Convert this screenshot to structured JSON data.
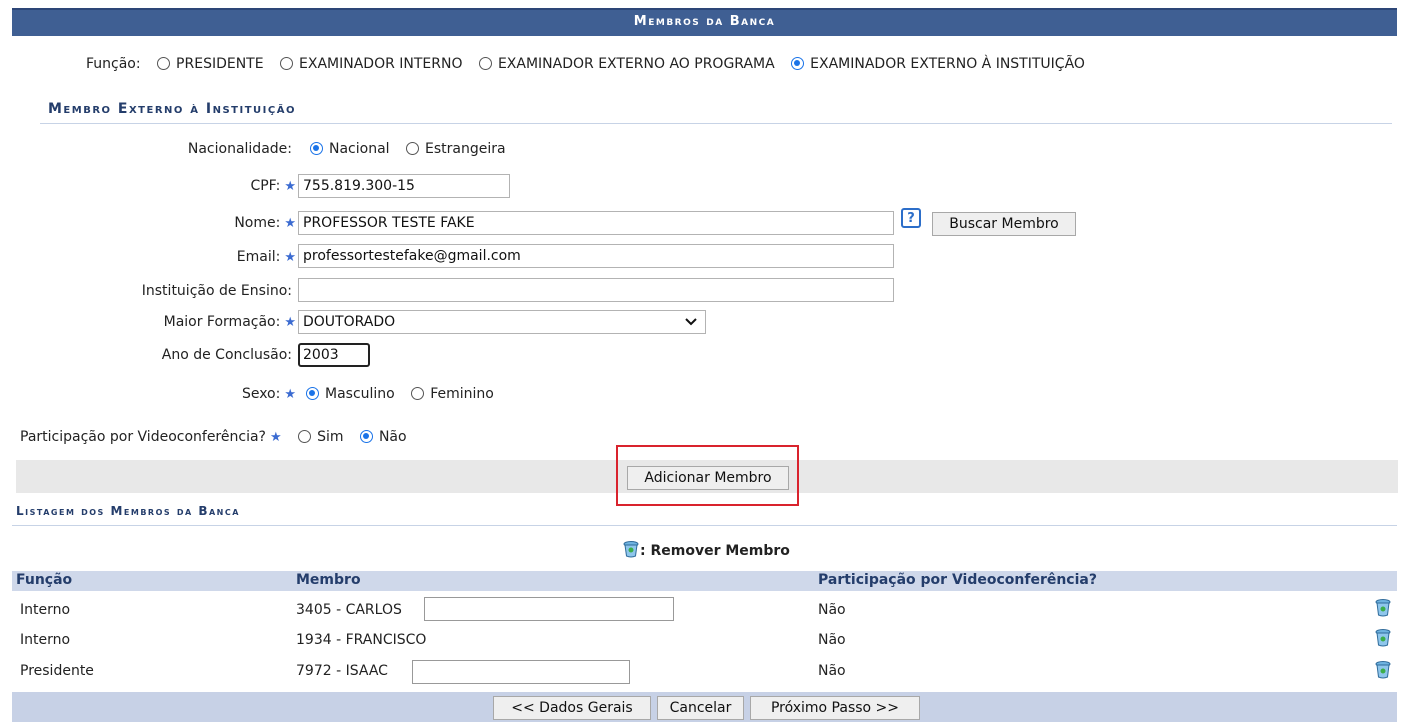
{
  "header": {
    "title": "Membros da Banca"
  },
  "funcao": {
    "label": "Função:",
    "options": [
      {
        "label": "PRESIDENTE",
        "selected": false
      },
      {
        "label": "EXAMINADOR INTERNO",
        "selected": false
      },
      {
        "label": "EXAMINADOR EXTERNO AO PROGRAMA",
        "selected": false
      },
      {
        "label": "EXAMINADOR EXTERNO À INSTITUIÇÃO",
        "selected": true
      }
    ]
  },
  "form": {
    "section_title": "Membro Externo à Instituição",
    "nacionalidade": {
      "label": "Nacionalidade:",
      "options": [
        {
          "label": "Nacional",
          "selected": true
        },
        {
          "label": "Estrangeira",
          "selected": false
        }
      ]
    },
    "cpf": {
      "label": "CPF:",
      "value": "755.819.300-15"
    },
    "nome": {
      "label": "Nome:",
      "value": "PROFESSOR TESTE FAKE",
      "help": "?",
      "search_button": "Buscar Membro"
    },
    "email": {
      "label": "Email:",
      "value": "professortestefake@gmail.com"
    },
    "instituicao": {
      "label": "Instituição de Ensino:",
      "value": ""
    },
    "maior_formacao": {
      "label": "Maior Formação:",
      "value": "DOUTORADO"
    },
    "ano_conclusao": {
      "label": "Ano de Conclusão:",
      "value": "2003"
    },
    "sexo": {
      "label": "Sexo:",
      "options": [
        {
          "label": "Masculino",
          "selected": true
        },
        {
          "label": "Feminino",
          "selected": false
        }
      ]
    },
    "videoconferencia": {
      "label": "Participação por Videoconferência?",
      "options": [
        {
          "label": "Sim",
          "selected": false
        },
        {
          "label": "Não",
          "selected": true
        }
      ]
    },
    "add_button": "Adicionar Membro"
  },
  "listing": {
    "section_title": "Listagem dos Membros da Banca",
    "legend": ": Remover Membro",
    "columns": [
      "Função",
      "Membro",
      "Participação por Videoconferência?"
    ],
    "rows": [
      {
        "funcao": "Interno",
        "membro": "3405 - CARLOS",
        "video": "Não"
      },
      {
        "funcao": "Interno",
        "membro": "1934 - FRANCISCO",
        "video": "Não"
      },
      {
        "funcao": "Presidente",
        "membro": "7972 - ISAAC",
        "video": "Não"
      }
    ]
  },
  "footer": {
    "back": "<< Dados Gerais",
    "cancel": "Cancelar",
    "next": "Próximo Passo >>"
  },
  "colors": {
    "header_bg": "#3f5f93",
    "accent_text": "#243d6b",
    "highlight_border": "#d9232d"
  }
}
